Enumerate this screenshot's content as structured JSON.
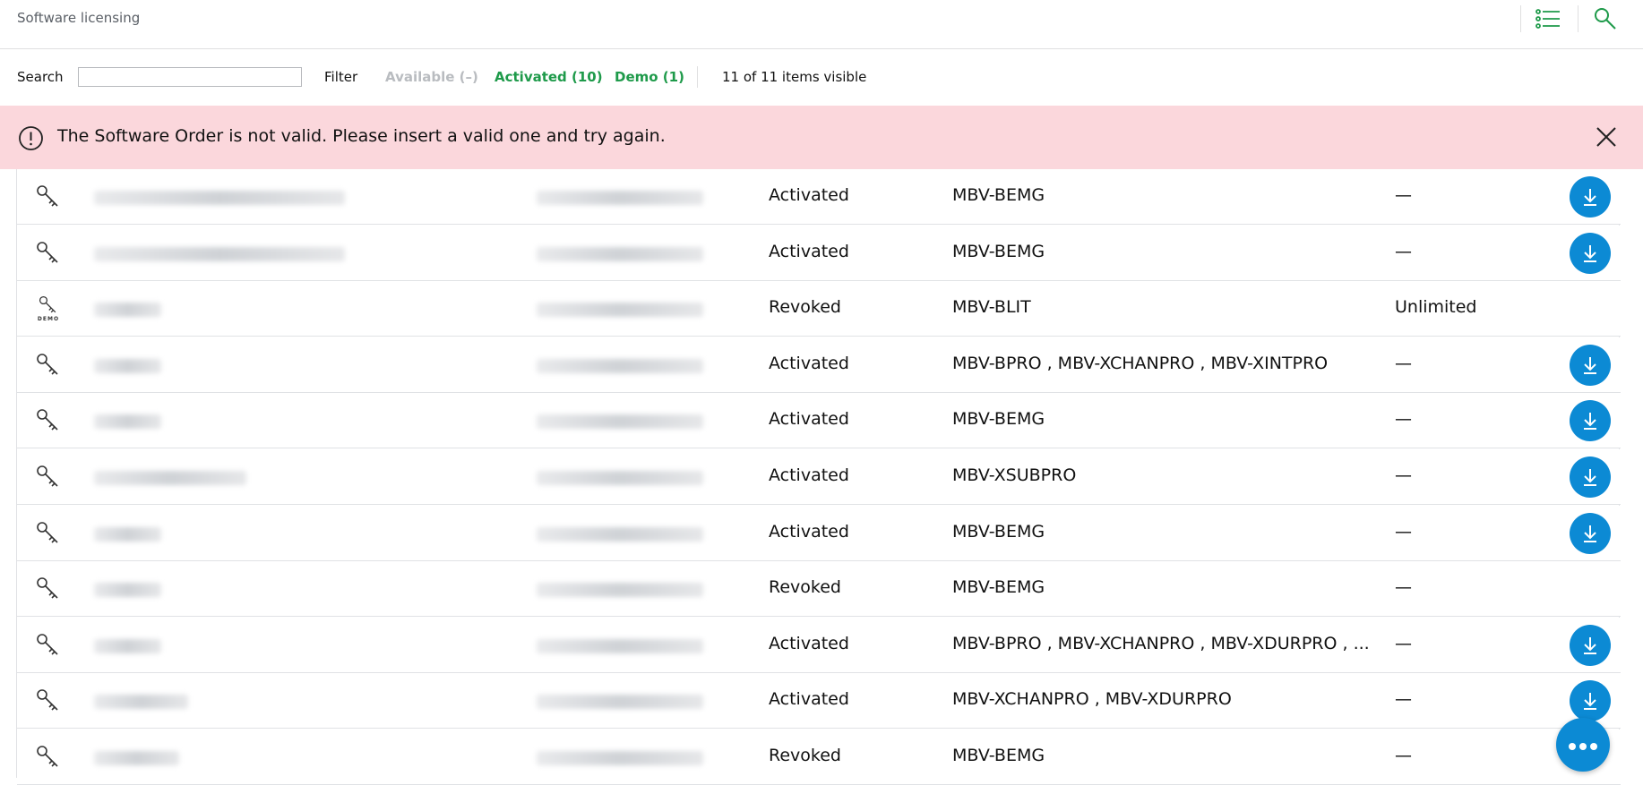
{
  "app": {
    "title": "Software licensing"
  },
  "header": {
    "list_icon": "list-view-icon",
    "search_icon": "search-icon"
  },
  "filterbar": {
    "search_label": "Search",
    "search_value": "",
    "filter_label": "Filter",
    "available": "Available (–)",
    "activated": "Activated (10)",
    "demo": "Demo (1)",
    "visible_count": "11 of 11 items visible"
  },
  "banner": {
    "message": "The Software Order is not valid. Please insert a valid one and try again.",
    "icon": "alert-circle-icon",
    "close_icon": "close-icon"
  },
  "colors": {
    "accent_blue": "#0c8ad4",
    "active_green": "#1e9a4a",
    "error_bg": "#fbd7dc"
  },
  "rows": [
    {
      "icon": "key-icon",
      "status": "Activated",
      "licenses": "MBV-BEMG",
      "expiry": "—",
      "download": true
    },
    {
      "icon": "key-icon",
      "status": "Activated",
      "licenses": "MBV-BEMG",
      "expiry": "—",
      "download": true
    },
    {
      "icon": "demo-key-icon",
      "demo_label": "DEMO",
      "status": "Revoked",
      "licenses": "MBV-BLIT",
      "expiry": "Unlimited",
      "download": false
    },
    {
      "icon": "key-icon",
      "status": "Activated",
      "licenses": "MBV-BPRO , MBV-XCHANPRO , MBV-XINTPRO",
      "expiry": "—",
      "download": true
    },
    {
      "icon": "key-icon",
      "status": "Activated",
      "licenses": "MBV-BEMG",
      "expiry": "—",
      "download": true
    },
    {
      "icon": "key-icon",
      "status": "Activated",
      "licenses": "MBV-XSUBPRO",
      "expiry": "—",
      "download": true
    },
    {
      "icon": "key-icon",
      "status": "Activated",
      "licenses": "MBV-BEMG",
      "expiry": "—",
      "download": true
    },
    {
      "icon": "key-icon",
      "status": "Revoked",
      "licenses": "MBV-BEMG",
      "expiry": "—",
      "download": false
    },
    {
      "icon": "key-icon",
      "status": "Activated",
      "licenses": "MBV-BPRO , MBV-XCHANPRO , MBV-XDURPRO , ...",
      "expiry": "—",
      "download": true
    },
    {
      "icon": "key-icon",
      "status": "Activated",
      "licenses": "MBV-XCHANPRO , MBV-XDURPRO",
      "expiry": "—",
      "download": true
    },
    {
      "icon": "key-icon",
      "status": "Revoked",
      "licenses": "MBV-BEMG",
      "expiry": "—",
      "download": false
    }
  ],
  "fab": {
    "icon": "more-options-icon"
  }
}
